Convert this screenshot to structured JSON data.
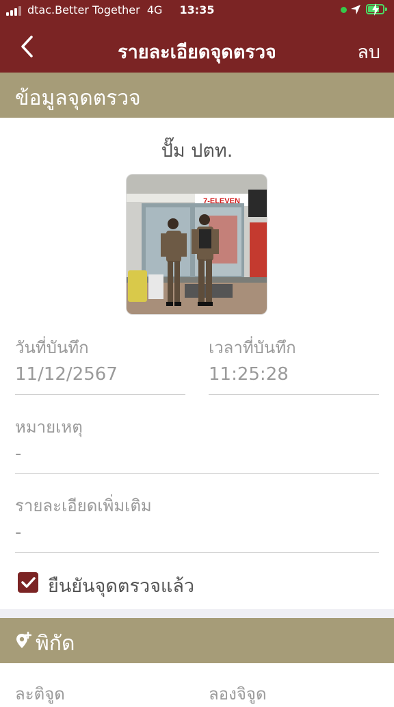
{
  "status_bar": {
    "carrier": "dtac.Better Together",
    "network": "4G",
    "time": "13:35"
  },
  "nav": {
    "title": "รายละเอียดจุดตรวจ",
    "delete_label": "ลบ"
  },
  "section_info": {
    "title": "ข้อมูลจุดตรวจ"
  },
  "checkpoint": {
    "name": "ปั๊ม ปตท.",
    "photo_sign_text": "7-ELEVEN"
  },
  "record_date": {
    "label": "วันที่บันทึก",
    "value": "11/12/2567"
  },
  "record_time": {
    "label": "เวลาที่บันทึก",
    "value": "11:25:28"
  },
  "note": {
    "label": "หมายเหตุ",
    "value": "-"
  },
  "details": {
    "label": "รายละเอียดเพิ่มเติม",
    "value": "-"
  },
  "confirm": {
    "label": "ยืนยันจุดตรวจแล้ว",
    "checked": true
  },
  "section_location": {
    "title": "พิกัด",
    "icon": "add-location-icon"
  },
  "coordinates": {
    "lat_label": "ละติจูด",
    "lng_label": "ลองจิจูด"
  },
  "colors": {
    "primary": "#7b2424",
    "section": "#a69c78",
    "muted_text": "#9a9a9a"
  }
}
